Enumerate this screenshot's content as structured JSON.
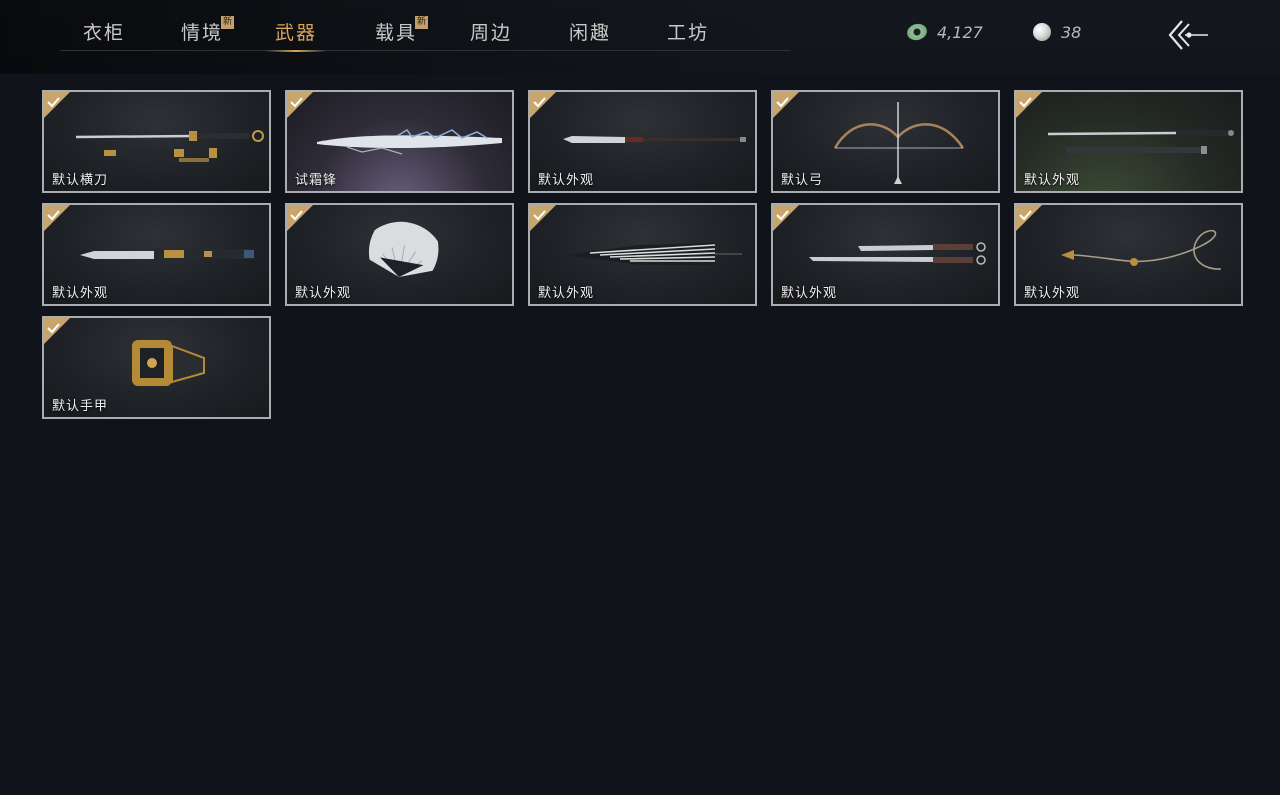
{
  "tabs": [
    {
      "label": "衣柜",
      "new": false,
      "active": false
    },
    {
      "label": "情境",
      "new": true,
      "active": false
    },
    {
      "label": "武器",
      "new": false,
      "active": true
    },
    {
      "label": "载具",
      "new": true,
      "active": false
    },
    {
      "label": "周边",
      "new": false,
      "active": false
    },
    {
      "label": "闲趣",
      "new": false,
      "active": false
    },
    {
      "label": "工坊",
      "new": false,
      "active": false
    }
  ],
  "new_badge": "新",
  "currency": {
    "jade": {
      "icon": "jade-coin-icon",
      "value": "4,127"
    },
    "pearl": {
      "icon": "pearl-icon",
      "value": "38"
    }
  },
  "back_icon": "back-arrow-icon",
  "items": [
    {
      "label": "默认横刀",
      "equipped": true,
      "art": "sword-with-scabbard"
    },
    {
      "label": "试霜锋",
      "equipped": true,
      "art": "frost-blade"
    },
    {
      "label": "默认外观",
      "equipped": true,
      "art": "spear"
    },
    {
      "label": "默认弓",
      "equipped": true,
      "art": "bow"
    },
    {
      "label": "默认外观",
      "equipped": true,
      "art": "long-sword"
    },
    {
      "label": "默认外观",
      "equipped": true,
      "art": "ornate-blade"
    },
    {
      "label": "默认外观",
      "equipped": true,
      "art": "folding-fan"
    },
    {
      "label": "默认外观",
      "equipped": true,
      "art": "umbrella"
    },
    {
      "label": "默认外观",
      "equipped": true,
      "art": "twin-sabres"
    },
    {
      "label": "默认外观",
      "equipped": true,
      "art": "rope-dart"
    },
    {
      "label": "默认手甲",
      "equipped": true,
      "art": "gauntlet"
    }
  ],
  "colors": {
    "accent": "#d9a45a",
    "background": "#10141a",
    "card_border": "#a9adb2",
    "check": "#c8a56a"
  }
}
